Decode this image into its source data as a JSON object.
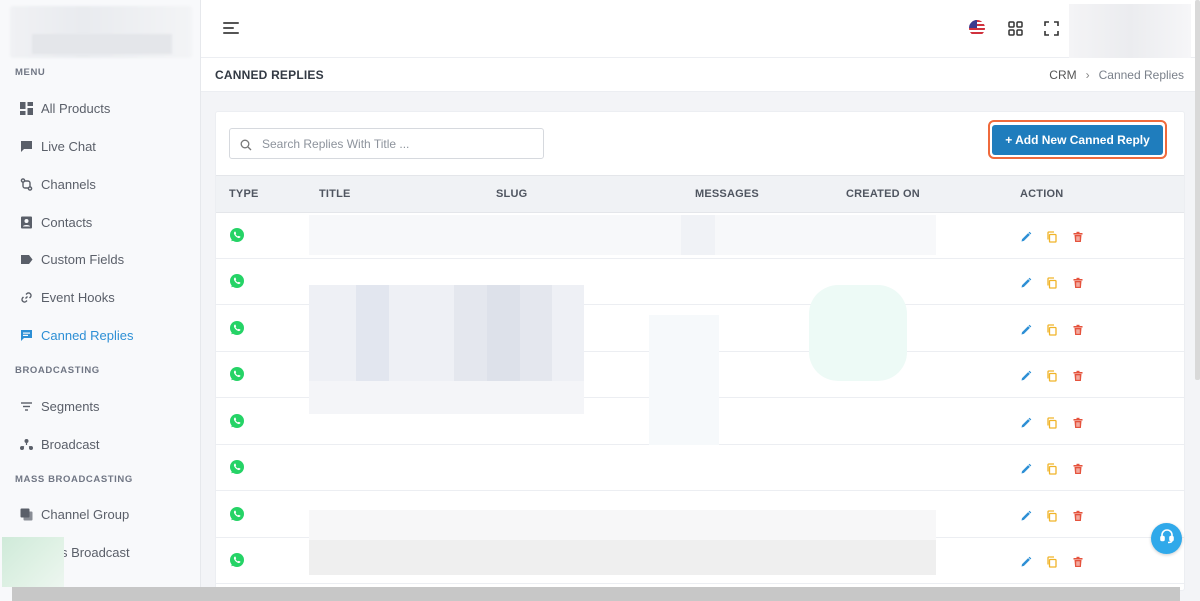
{
  "sidebar": {
    "sections": {
      "menu": "MENU",
      "broadcasting": "BROADCASTING",
      "mass_broadcasting": "MASS BROADCASTING"
    },
    "items": [
      {
        "label": "All Products",
        "icon": "grid-icon"
      },
      {
        "label": "Live Chat",
        "icon": "chat-bubble-icon"
      },
      {
        "label": "Channels",
        "icon": "channels-icon"
      },
      {
        "label": "Contacts",
        "icon": "contacts-book-icon"
      },
      {
        "label": "Custom Fields",
        "icon": "tag-icon"
      },
      {
        "label": "Event Hooks",
        "icon": "link-icon"
      },
      {
        "label": "Canned Replies",
        "icon": "message-square-icon",
        "active": true
      },
      {
        "label": "Segments",
        "icon": "filter-lines-icon"
      },
      {
        "label": "Broadcast",
        "icon": "broadcast-icon"
      },
      {
        "label": "Channel Group",
        "icon": "copy-icon"
      },
      {
        "label": "s Broadcast",
        "icon": "broadcast-icon"
      }
    ]
  },
  "page": {
    "title": "CANNED REPLIES",
    "breadcrumb": [
      "CRM",
      "Canned Replies"
    ]
  },
  "toolbar": {
    "search_placeholder": "Search Replies With Title ...",
    "add_button_label": "+ Add New Canned Reply"
  },
  "table": {
    "columns": [
      "TYPE",
      "TITLE",
      "SLUG",
      "MESSAGES",
      "CREATED ON",
      "ACTION"
    ],
    "row_count": 8
  },
  "colors": {
    "accent": "#2d8fd5",
    "primary_button": "#1f7dbd",
    "whatsapp": "#25d366",
    "edit": "#2d8fd5",
    "copy": "#f0b429",
    "delete": "#e5533d"
  }
}
